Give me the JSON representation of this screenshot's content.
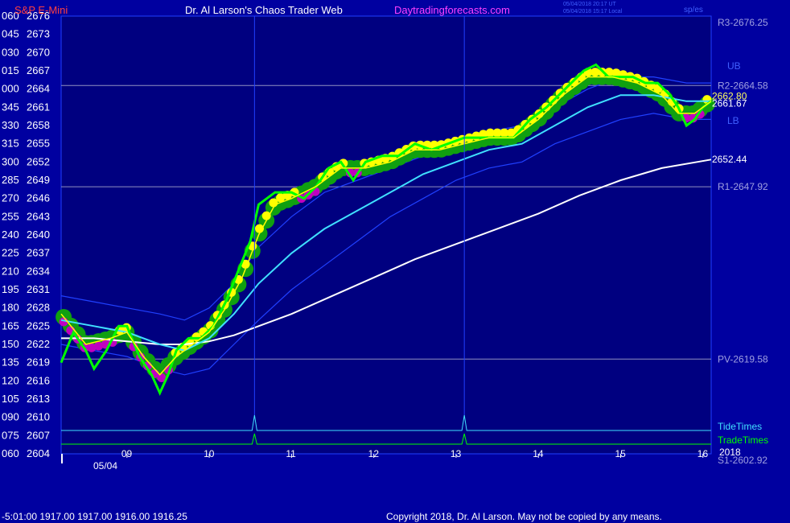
{
  "header": {
    "symbol": "S&P E-Mini",
    "title": "Dr. Al Larson's Chaos Trader Web",
    "site": "Daytradingforecasts.com",
    "stamp_utc": "05/04/2018 20:17 UT",
    "stamp_local": "05/04/2018 15:17 Local",
    "tag": "sp/es"
  },
  "footer": {
    "quote": "-5:01:00  1917.00 1917.00 1916.00 1916.25",
    "copyright": "Copyright 2018, Dr. Al Larson. May not be copied by any means."
  },
  "colors": {
    "background": "#0000a0",
    "plot_bg": "#000080",
    "price": "#00ff00",
    "halo": "#10a010",
    "yellow": "#ffff00",
    "magenta": "#c000c0",
    "cyan_ma": "#40e0ff",
    "white_ma": "#ffffff",
    "band": "#2040ff",
    "tide": "#40e0ff",
    "trade": "#00ff00"
  },
  "chart_data": {
    "type": "line",
    "y_range": [
      2604,
      2676
    ],
    "y_ticks": [
      {
        "left": "060",
        "price": "2676"
      },
      {
        "left": "045",
        "price": "2673"
      },
      {
        "left": "030",
        "price": "2670"
      },
      {
        "left": "015",
        "price": "2667"
      },
      {
        "left": "000",
        "price": "2664"
      },
      {
        "left": "345",
        "price": "2661"
      },
      {
        "left": "330",
        "price": "2658"
      },
      {
        "left": "315",
        "price": "2655"
      },
      {
        "left": "300",
        "price": "2652"
      },
      {
        "left": "285",
        "price": "2649"
      },
      {
        "left": "270",
        "price": "2646"
      },
      {
        "left": "255",
        "price": "2643"
      },
      {
        "left": "240",
        "price": "2640"
      },
      {
        "left": "225",
        "price": "2637"
      },
      {
        "left": "210",
        "price": "2634"
      },
      {
        "left": "195",
        "price": "2631"
      },
      {
        "left": "180",
        "price": "2628"
      },
      {
        "left": "165",
        "price": "2625"
      },
      {
        "left": "150",
        "price": "2622"
      },
      {
        "left": "135",
        "price": "2619"
      },
      {
        "left": "120",
        "price": "2616"
      },
      {
        "left": "105",
        "price": "2613"
      },
      {
        "left": "090",
        "price": "2610"
      },
      {
        "left": "075",
        "price": "2607"
      },
      {
        "left": "060",
        "price": "2604"
      }
    ],
    "x_ticks": [
      "09",
      "10",
      "11",
      "12",
      "13",
      "14",
      "15",
      "16"
    ],
    "x_tick_hours": [
      9,
      10,
      11,
      12,
      13,
      14,
      15,
      16
    ],
    "x_range_hours": [
      8.2,
      16.1
    ],
    "date_label": "05/04",
    "pivot_levels": [
      {
        "label": "R3-2676.25",
        "value": 2676.25,
        "drawn": false
      },
      {
        "label": "R2-2664.58",
        "value": 2664.58,
        "drawn": true
      },
      {
        "label": "R1-2647.92",
        "value": 2647.92,
        "drawn": true
      },
      {
        "label": "PV-2619.58",
        "value": 2619.58,
        "drawn": true
      },
      {
        "label": "S1-2602.92",
        "value": 2602.92,
        "drawn": false
      }
    ],
    "price_labels": [
      {
        "text": "2662.80",
        "value": 2662.8
      },
      {
        "text": "2661.67",
        "value": 2661.67
      },
      {
        "text": "2652.44",
        "value": 2652.44
      }
    ],
    "band_labels": [
      "UB",
      "LB"
    ],
    "indicators": [
      {
        "label": "TideTimes",
        "spikes_hours": [
          10.55,
          13.1
        ]
      },
      {
        "label": "TradeTimes",
        "spikes_hours": [
          10.55,
          13.1
        ]
      }
    ],
    "year_label": "2018",
    "series": [
      {
        "key": "price",
        "x": [
          8.2,
          8.35,
          8.5,
          8.6,
          8.75,
          8.9,
          9.0,
          9.15,
          9.3,
          9.4,
          9.5,
          9.6,
          9.75,
          9.9,
          10.05,
          10.2,
          10.35,
          10.5,
          10.6,
          10.8,
          11.0,
          11.15,
          11.3,
          11.45,
          11.6,
          11.75,
          11.9,
          12.1,
          12.3,
          12.5,
          12.7,
          12.9,
          13.1,
          13.3,
          13.5,
          13.7,
          13.9,
          14.1,
          14.25,
          14.4,
          14.55,
          14.7,
          14.85,
          15.0,
          15.15,
          15.3,
          15.45,
          15.6,
          15.7,
          15.8,
          15.9,
          16.0,
          16.1
        ],
        "y": [
          2619,
          2624,
          2621,
          2618,
          2621,
          2625,
          2625,
          2620,
          2617,
          2614,
          2617,
          2621,
          2623,
          2623,
          2625,
          2629,
          2634,
          2639,
          2645,
          2647,
          2647,
          2646,
          2648,
          2651,
          2652,
          2649,
          2652,
          2653,
          2653,
          2655,
          2654,
          2655,
          2656,
          2656,
          2656,
          2656,
          2659,
          2661,
          2663,
          2665,
          2667,
          2668,
          2666,
          2666,
          2666,
          2665,
          2665,
          2663,
          2661,
          2658,
          2659,
          2661,
          2662
        ]
      },
      {
        "key": "yellow_ma",
        "x": [
          8.2,
          8.5,
          8.8,
          9.0,
          9.2,
          9.4,
          9.6,
          9.8,
          10.0,
          10.2,
          10.4,
          10.6,
          10.8,
          11.0,
          11.3,
          11.6,
          11.9,
          12.2,
          12.5,
          12.8,
          13.1,
          13.4,
          13.7,
          14.0,
          14.3,
          14.6,
          14.9,
          15.2,
          15.5,
          15.7,
          15.9,
          16.1
        ],
        "y": [
          2627,
          2622,
          2623,
          2624,
          2620,
          2617,
          2620,
          2622,
          2624,
          2628,
          2633,
          2640,
          2645,
          2646,
          2648,
          2651,
          2651,
          2652,
          2654,
          2654,
          2655,
          2656,
          2656,
          2659,
          2663,
          2666,
          2666,
          2665,
          2663,
          2660,
          2660,
          2662
        ]
      },
      {
        "key": "cyan_ma",
        "x": [
          8.2,
          8.6,
          9.0,
          9.4,
          9.7,
          10.0,
          10.3,
          10.6,
          11.0,
          11.4,
          11.8,
          12.2,
          12.6,
          13.0,
          13.4,
          13.8,
          14.2,
          14.6,
          15.0,
          15.4,
          15.8,
          16.1
        ],
        "y": [
          2626,
          2625,
          2624,
          2622,
          2621,
          2623,
          2627,
          2632,
          2637,
          2641,
          2644,
          2647,
          2650,
          2652,
          2654,
          2655,
          2658,
          2661,
          2663,
          2663,
          2662,
          2662
        ]
      },
      {
        "key": "white_ma",
        "x": [
          8.2,
          8.6,
          9.0,
          9.4,
          9.7,
          10.0,
          10.3,
          10.6,
          11.0,
          11.5,
          12.0,
          12.5,
          13.0,
          13.5,
          14.0,
          14.5,
          15.0,
          15.5,
          16.1
        ],
        "y": [
          2623,
          2623,
          2622.5,
          2622,
          2622,
          2622.5,
          2623.5,
          2625,
          2627,
          2630,
          2633,
          2636,
          2638.5,
          2641,
          2643.5,
          2646.5,
          2649,
          2651,
          2652.4
        ]
      },
      {
        "key": "upper_band",
        "x": [
          8.2,
          8.6,
          9.0,
          9.4,
          9.7,
          10.0,
          10.3,
          10.6,
          11.0,
          11.4,
          11.8,
          12.2,
          12.6,
          13.0,
          13.4,
          13.8,
          14.2,
          14.6,
          15.0,
          15.4,
          15.8,
          16.1
        ],
        "y": [
          2630,
          2629,
          2628,
          2627,
          2626,
          2628,
          2632,
          2638,
          2643,
          2647,
          2649,
          2651,
          2653,
          2655,
          2657,
          2658,
          2661,
          2664,
          2666,
          2666,
          2665,
          2665
        ]
      },
      {
        "key": "lower_band",
        "x": [
          8.2,
          8.6,
          9.0,
          9.4,
          9.7,
          10.0,
          10.3,
          10.6,
          11.0,
          11.4,
          11.8,
          12.2,
          12.6,
          13.0,
          13.4,
          13.8,
          14.2,
          14.6,
          15.0,
          15.4,
          15.8,
          16.1
        ],
        "y": [
          2622,
          2621,
          2620,
          2618,
          2617,
          2618,
          2622,
          2626,
          2631,
          2635,
          2639,
          2643,
          2646,
          2649,
          2651,
          2652,
          2655,
          2657,
          2659,
          2660,
          2659,
          2659
        ]
      }
    ]
  }
}
